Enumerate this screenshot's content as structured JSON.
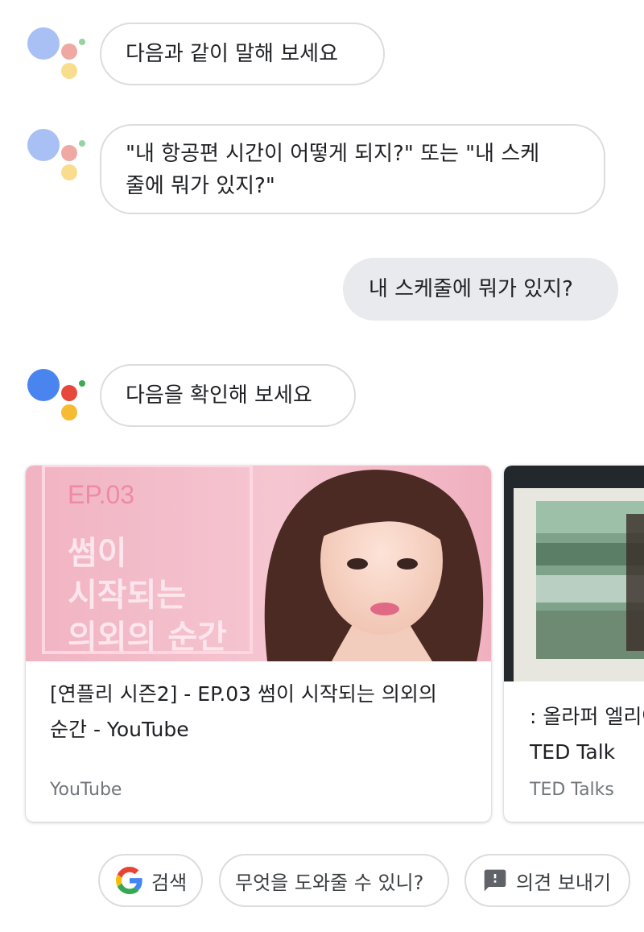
{
  "conversation": {
    "assistant_prompt_1": "다음과 같이 말해 보세요",
    "assistant_suggestion_line1": "\"내 항공편 시간이 어떻게 되지?\" 또는 \"내 스케",
    "assistant_suggestion_line2": "줄에 뭐가 있지?\"",
    "user_query": "내 스케줄에 뭐가 있지?",
    "assistant_response": "다음을 확인해 보세요"
  },
  "cards": [
    {
      "thumb_ep": "EP.03",
      "thumb_line1": "썸이",
      "thumb_line2": "시작되는",
      "thumb_line3": "의외의 순간",
      "title_line1": "[연플리 시즌2] - EP.03 썸이 시작되는 의외의",
      "title_line2": "순간 - YouTube",
      "source": "YouTube"
    },
    {
      "title_line1": ": 올라퍼 엘리아",
      "title_line2": "TED Talk",
      "source": "TED Talks"
    }
  ],
  "chips": {
    "search": "검색",
    "help": "무엇을 도와줄 수 있니?",
    "feedback": "의견 보내기"
  },
  "colors": {
    "assistant_blue": "#4a84ee",
    "assistant_red": "#e6493b",
    "assistant_yellow": "#f5bb32",
    "assistant_green": "#3fa956",
    "user_bubble": "#e9eaee",
    "thumb_pink": "#f2b8c6"
  },
  "icons": {
    "logo": "google-assistant-icon",
    "search": "google-g-icon",
    "feedback": "feedback-icon"
  }
}
